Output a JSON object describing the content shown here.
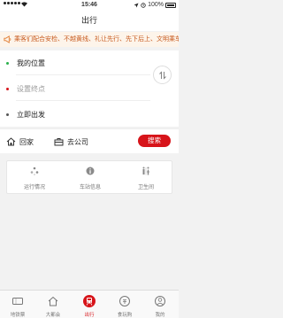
{
  "status_bar": {
    "time": "15:46",
    "battery": "100%"
  },
  "header": {
    "title": "出行"
  },
  "notice": {
    "text": "乘客们配合安检、不越黄线、礼让先行、先下后上、文明乘车"
  },
  "route": {
    "start_label": "我的位置",
    "end_placeholder": "设置终点",
    "depart_label": "立即出发"
  },
  "shortcuts": {
    "home_label": "回家",
    "work_label": "去公司",
    "search_label": "搜索"
  },
  "services": [
    {
      "label": "运行情况",
      "icon": "status-icon"
    },
    {
      "label": "车站信息",
      "icon": "info-icon"
    },
    {
      "label": "卫生间",
      "icon": "restroom-icon"
    }
  ],
  "tabs": [
    {
      "label": "地铁票",
      "icon": "ticket-icon"
    },
    {
      "label": "大都会",
      "icon": "home-icon"
    },
    {
      "label": "出行",
      "icon": "train-icon"
    },
    {
      "label": "食玩购",
      "icon": "shop-icon"
    },
    {
      "label": "我的",
      "icon": "profile-icon"
    }
  ],
  "colors": {
    "accent": "#d7141a",
    "notice_text": "#c85a1e",
    "start_dot": "#2bb14c",
    "end_dot": "#d7141a",
    "depart_dot": "#555555"
  }
}
